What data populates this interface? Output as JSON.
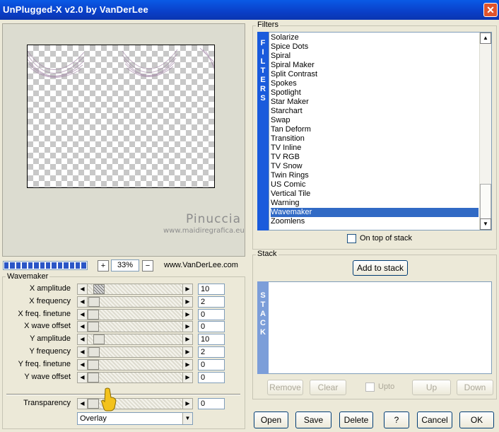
{
  "window": {
    "title": "UnPlugged-X v2.0 by VanDerLee",
    "close_symbol": "✕"
  },
  "preview": {
    "watermark_name": "Pinuccia",
    "watermark_site": "www.maidiregrafica.eu"
  },
  "zoom": {
    "progress_percent": 100,
    "minus": "−",
    "plus": "+",
    "value": "33%",
    "site": "www.VanDerLee.com"
  },
  "wavemaker": {
    "title": "Wavemaker",
    "params": [
      {
        "label": "X amplitude",
        "value": "10",
        "level": 0.06
      },
      {
        "label": "X frequency",
        "value": "2",
        "level": 0.01
      },
      {
        "label": "X freq. finetune",
        "value": "0",
        "level": 0.0
      },
      {
        "label": "X wave offset",
        "value": "0",
        "level": 0.0
      },
      {
        "label": "Y amplitude",
        "value": "10",
        "level": 0.06
      },
      {
        "label": "Y frequency",
        "value": "2",
        "level": 0.01
      },
      {
        "label": "Y freq. finetune",
        "value": "0",
        "level": 0.0
      },
      {
        "label": "Y wave offset",
        "value": "0",
        "level": 0.0
      }
    ],
    "transparency": {
      "label": "Transparency",
      "value": "0",
      "level": 0.0
    },
    "blend_mode": "Overlay"
  },
  "filters": {
    "title": "Filters",
    "side_letters": [
      "F",
      "I",
      "L",
      "T",
      "E",
      "R",
      "S"
    ],
    "items": [
      "Solarize",
      "Spice Dots",
      "Spiral",
      "Spiral Maker",
      "Split Contrast",
      "Spokes",
      "Spotlight",
      "Star Maker",
      "Starchart",
      "Swap",
      "Tan Deform",
      "Transition",
      "TV Inline",
      "TV RGB",
      "TV Snow",
      "Twin Rings",
      "US Comic",
      "Vertical Tile",
      "Warning",
      "Wavemaker",
      "Zoomlens"
    ],
    "selected": "Wavemaker",
    "on_top_label": "On top of stack",
    "on_top_checked": false
  },
  "stack": {
    "title": "Stack",
    "side_letters": [
      "S",
      "T",
      "A",
      "C",
      "K"
    ],
    "add_label": "Add to stack",
    "remove_label": "Remove",
    "clear_label": "Clear",
    "upto_label": "Upto",
    "up_label": "Up",
    "down_label": "Down"
  },
  "footer": {
    "open": "Open",
    "save": "Save",
    "delete": "Delete",
    "help": "?",
    "cancel": "Cancel",
    "ok": "OK"
  },
  "colors": {
    "title_bar": "#0a4fd8",
    "selection": "#316ac5",
    "side_bar_filters": "#1a5bdc",
    "side_bar_stack": "#7c9ed9"
  }
}
